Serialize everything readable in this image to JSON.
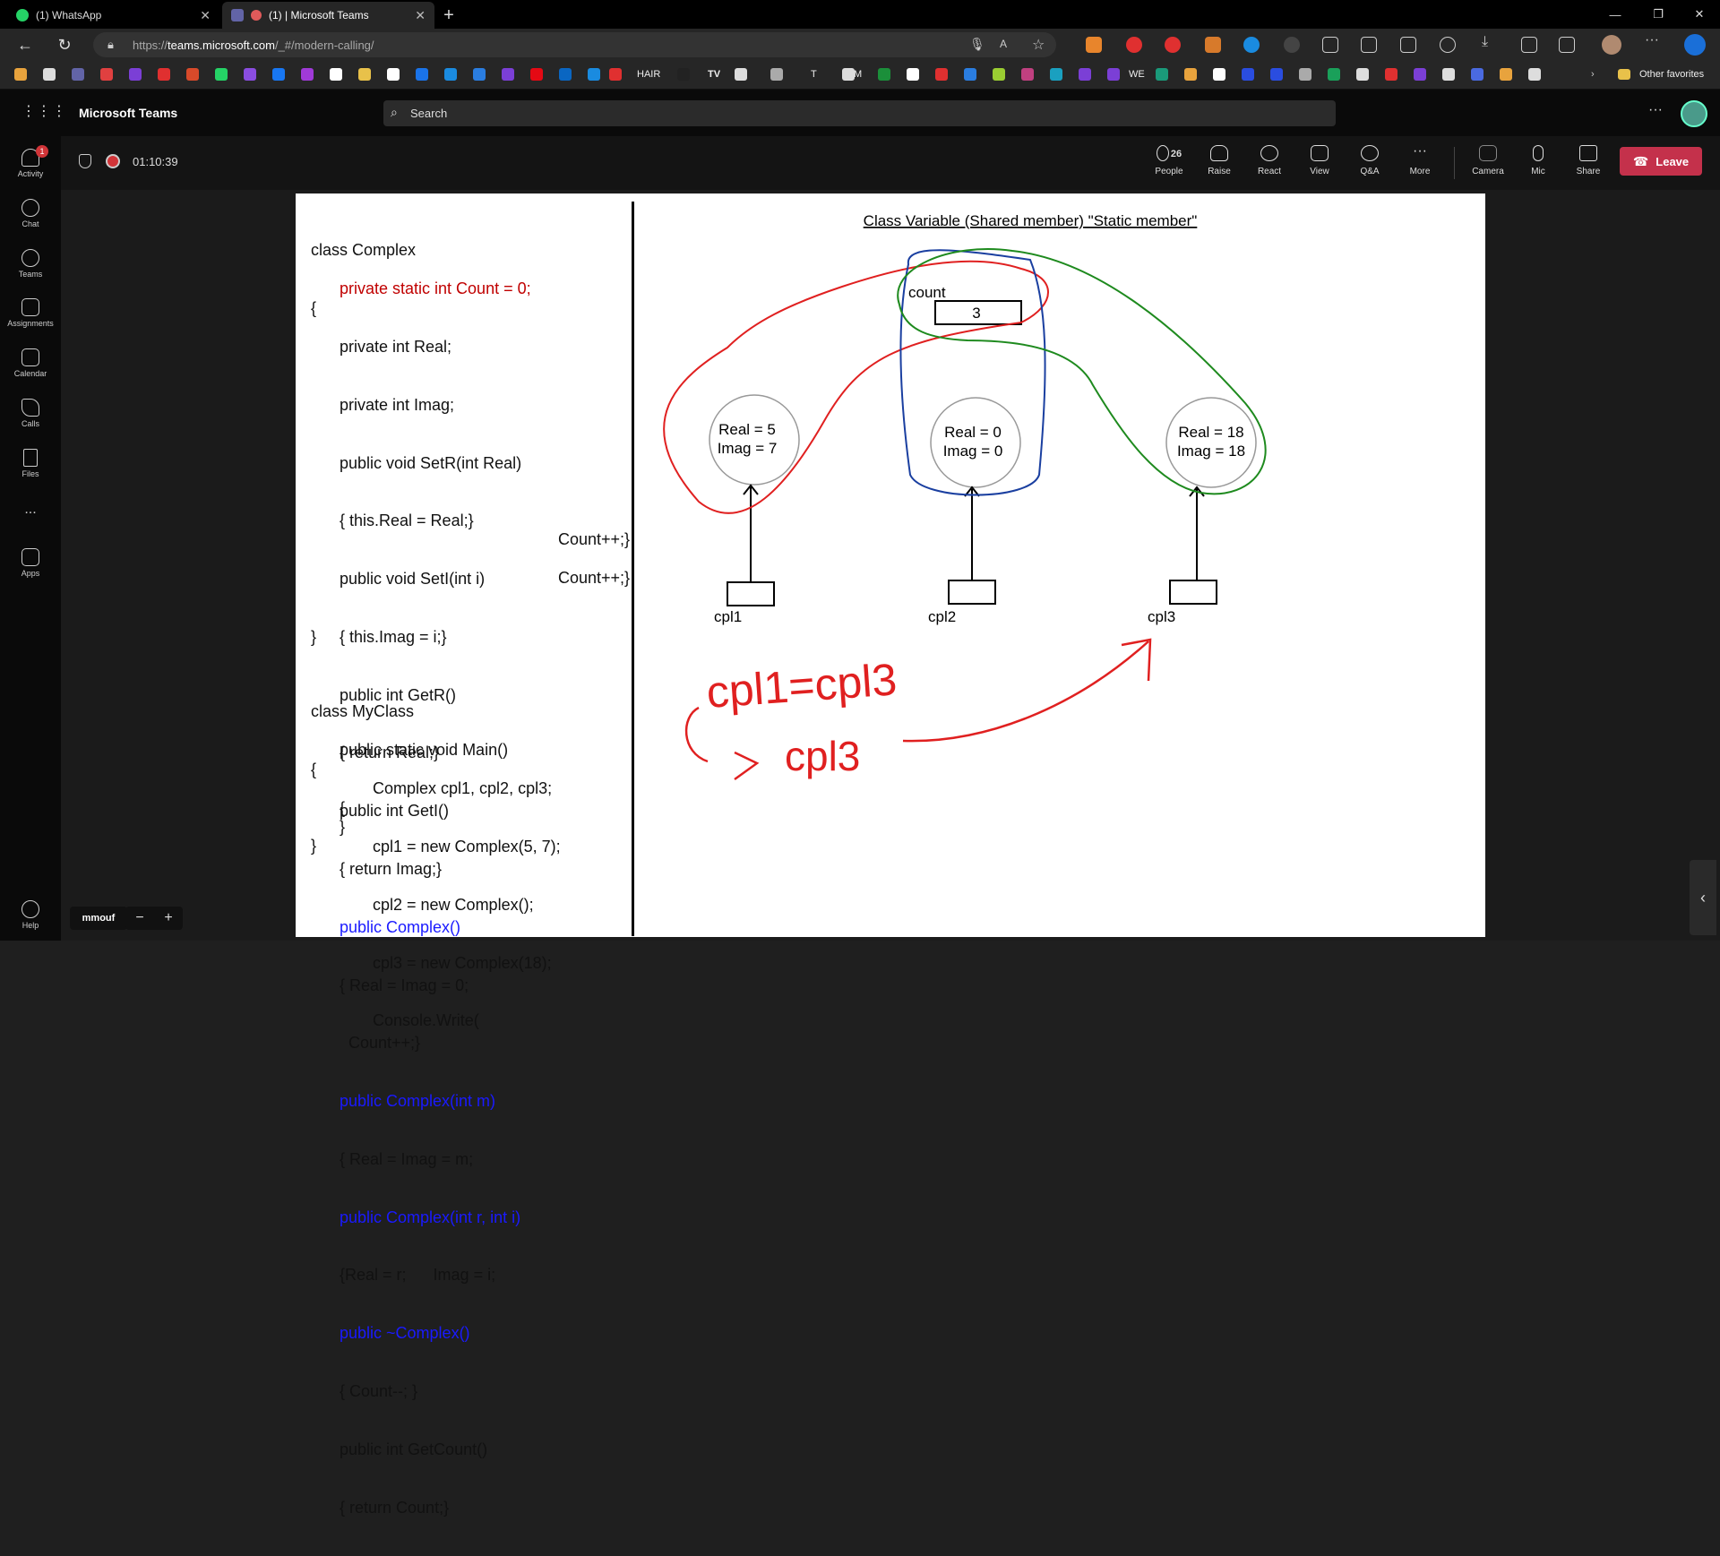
{
  "browser": {
    "tabs": [
      {
        "label": "(1) WhatsApp",
        "active": false
      },
      {
        "label": "(1) | Microsoft Teams",
        "active": true
      }
    ],
    "url_prefix": "https://",
    "url_host": "teams.microsoft.com",
    "url_path": "/_#/modern-calling/",
    "favorites_text": {
      "hair": "HAIR",
      "tv": "TV",
      "t": "T",
      "m": "M",
      "we": "WE"
    },
    "other_favorites": "Other favorites",
    "brand_accent": "#6264a7"
  },
  "teams": {
    "app_title": "Microsoft Teams",
    "search_placeholder": "Search",
    "rail": {
      "activity": "Activity",
      "activity_badge": "1",
      "chat": "Chat",
      "teams": "Teams",
      "assignments": "Assignments",
      "calendar": "Calendar",
      "calls": "Calls",
      "files": "Files",
      "more": "...",
      "apps": "Apps",
      "help": "Help"
    },
    "meeting": {
      "timer": "01:10:39",
      "people_count": "26",
      "people": "People",
      "raise": "Raise",
      "react": "React",
      "view": "View",
      "qa": "Q&A",
      "more": "More",
      "camera": "Camera",
      "mic": "Mic",
      "share": "Share",
      "leave": "Leave"
    },
    "presenter": "mmouf",
    "zoom_minus": "−",
    "zoom_plus": "+"
  },
  "slide": {
    "code_left": {
      "l1": "class Complex",
      "l2": "{",
      "l3": "private static int Count = 0;",
      "l4": "private int Real;",
      "l5": "private int Imag;",
      "l6": "public void SetR(int Real)",
      "l7": "{ this.Real = Real;}",
      "l8": "public void SetI(int i)",
      "l9": "{ this.Imag = i;}",
      "l10": "public int GetR()",
      "l11": "{ return Real;}",
      "l12": "public int GetI()",
      "l13": "{ return Imag;}",
      "l14": "public Complex()",
      "l15": "{ Real = Imag = 0;",
      "l16": "  Count++;}",
      "l17": "public Complex(int m)",
      "l18": "{ Real = Imag = m;",
      "l18b": "Count++;}",
      "l19": "public Complex(int r, int i)",
      "l20a": "{Real = r;",
      "l20b": "Imag = i;",
      "l20c": "Count++;}",
      "l21": "public ~Complex()",
      "l22": "{ Count--; }",
      "l23": "public int GetCount()",
      "l24": "{ return Count;}",
      "l25": "}",
      "l26": "class MyClass",
      "l27": "{",
      "l28": "public static void Main()",
      "l29": "{",
      "l30": "Complex cpl1, cpl2, cpl3;",
      "l31": "cpl1 = new Complex(5, 7);",
      "l32": "cpl2 = new Complex();",
      "l33": "cpl3 = new Complex(18);",
      "l34": "Console.Write(",
      "l35": "}",
      "l36": "}"
    },
    "diagram": {
      "title": "Class Variable (Shared member) \"Static member\"",
      "count_label": "count",
      "count_value": "3",
      "obj1": {
        "real": "Real = 5",
        "imag": "Imag = 7"
      },
      "obj2": {
        "real": "Real = 0",
        "imag": "Imag = 0"
      },
      "obj3": {
        "real": "Real = 18",
        "imag": "Imag = 18"
      },
      "var1": "cpl1",
      "var2": "cpl2",
      "var3": "cpl3",
      "handwriting1": "cpl1=cpl3",
      "handwriting2": "cpl3"
    }
  }
}
